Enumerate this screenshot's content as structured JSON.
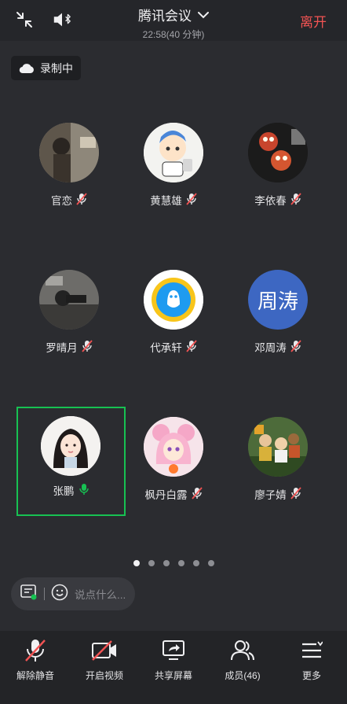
{
  "header": {
    "title": "腾讯会议",
    "subtitle": "22:58(40 分钟)",
    "leave_label": "离开",
    "leave_color": "#f25353"
  },
  "recording": {
    "label": "录制中",
    "icon": "cloud-icon"
  },
  "participants": [
    {
      "name": "官恋",
      "avatar": "photo",
      "muted": true
    },
    {
      "name": "黄慧雄",
      "avatar": "cartoon-boy",
      "muted": true
    },
    {
      "name": "李依春",
      "avatar": "photo-birds",
      "muted": true
    },
    {
      "name": "罗晴月",
      "avatar": "photo-bw",
      "muted": true
    },
    {
      "name": "代承轩",
      "avatar": "qq-penguin",
      "muted": true
    },
    {
      "name": "邓周涛",
      "avatar_text": "周涛",
      "avatar_color": "#3d67c2",
      "muted": true
    },
    {
      "name": "张鹏",
      "avatar": "anime-girl",
      "muted": false,
      "speaking": true
    },
    {
      "name": "枫丹白露",
      "avatar": "sailor-moon",
      "muted": true
    },
    {
      "name": "廖子婧",
      "avatar": "toy-story",
      "muted": true
    }
  ],
  "pagination": {
    "total": 6,
    "current": 1
  },
  "chat": {
    "placeholder": "说点什么..."
  },
  "toolbar": {
    "unmute": "解除静音",
    "start_video": "开启视频",
    "share_screen": "共享屏幕",
    "members": "成员(46)",
    "more": "更多"
  },
  "accent_speaking": "#17c152"
}
